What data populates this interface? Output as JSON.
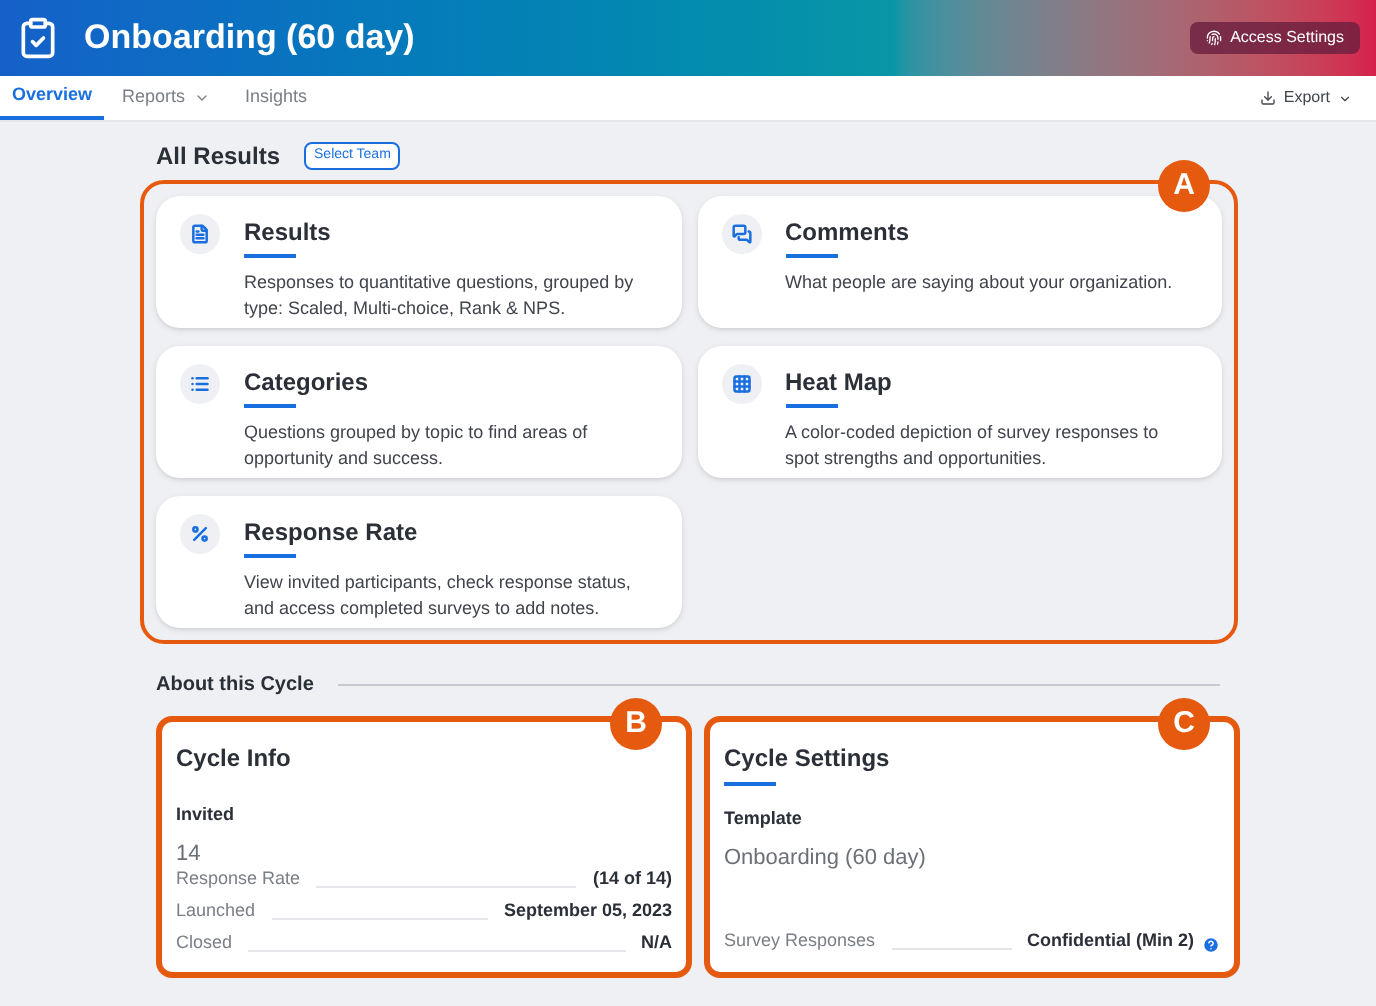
{
  "header": {
    "title": "Onboarding (60 day)",
    "action": "Access Settings"
  },
  "tabs": [
    {
      "label": "Overview",
      "selected": true,
      "menu": false
    },
    {
      "label": "Reports",
      "selected": false,
      "menu": true
    },
    {
      "label": "Insights",
      "selected": false,
      "menu": false
    }
  ],
  "export": "Export",
  "results": {
    "title": "All Results",
    "button": "Select Team",
    "callout": "A",
    "cards": [
      {
        "kind": "document",
        "title": "Results",
        "text": "Responses to quantitative questions, grouped by type: Scaled, Multi-choice, Rank & NPS."
      },
      {
        "kind": "comments",
        "title": "Comments",
        "text": "What people are saying about your organization."
      },
      {
        "kind": "list",
        "title": "Categories",
        "text": "Questions grouped by topic to find areas of opportunity and success."
      },
      {
        "kind": "grid",
        "title": "Heat Map",
        "text": "A color-coded depiction of survey responses to spot strengths and opportunities."
      },
      {
        "kind": "percent",
        "title": "Response Rate",
        "text": "View invited participants, check response status, and access completed surveys to add notes."
      }
    ]
  },
  "cycle": {
    "title": "About this Cycle",
    "info": {
      "title": "Cycle Info",
      "callout": "B",
      "field_label": "Invited",
      "field_value": "14",
      "rows": [
        {
          "label": "Response Rate",
          "value": "(14 of 14)"
        },
        {
          "label": "Launched",
          "value": "September 05, 2023"
        },
        {
          "label": "Closed",
          "value": "N/A"
        }
      ]
    },
    "settings": {
      "title": "Cycle Settings",
      "callout": "C",
      "field_label": "Template",
      "field_value": "Onboarding (60 day)",
      "rows": [
        {
          "label": "Survey Responses",
          "value": "Confidential (Min 2)",
          "help": true
        }
      ]
    }
  }
}
